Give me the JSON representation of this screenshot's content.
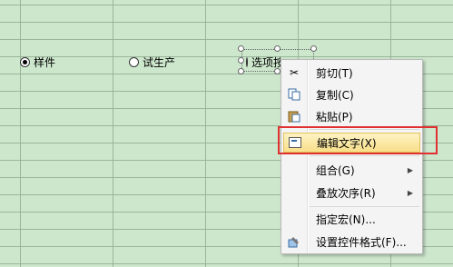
{
  "radios": [
    {
      "label": "样件",
      "checked": true
    },
    {
      "label": "试生产",
      "checked": false
    },
    {
      "label": "选项按钮",
      "checked": false
    }
  ],
  "context_menu": {
    "items": [
      {
        "label": "剪切(T)",
        "icon": "scissors-icon"
      },
      {
        "label": "复制(C)",
        "icon": "copy-icon"
      },
      {
        "label": "粘贴(P)",
        "icon": "paste-icon"
      },
      {
        "label": "编辑文字(X)",
        "icon": "edit-text-icon",
        "highlighted": true
      },
      {
        "label": "组合(G)",
        "icon": "",
        "submenu": true
      },
      {
        "label": "叠放次序(R)",
        "icon": "",
        "submenu": true
      },
      {
        "label": "指定宏(N)...",
        "icon": ""
      },
      {
        "label": "设置控件格式(F)...",
        "icon": "format-control-icon"
      }
    ]
  },
  "colors": {
    "highlight_box": "#e03030",
    "sheet_bg": "#cde7cd"
  }
}
